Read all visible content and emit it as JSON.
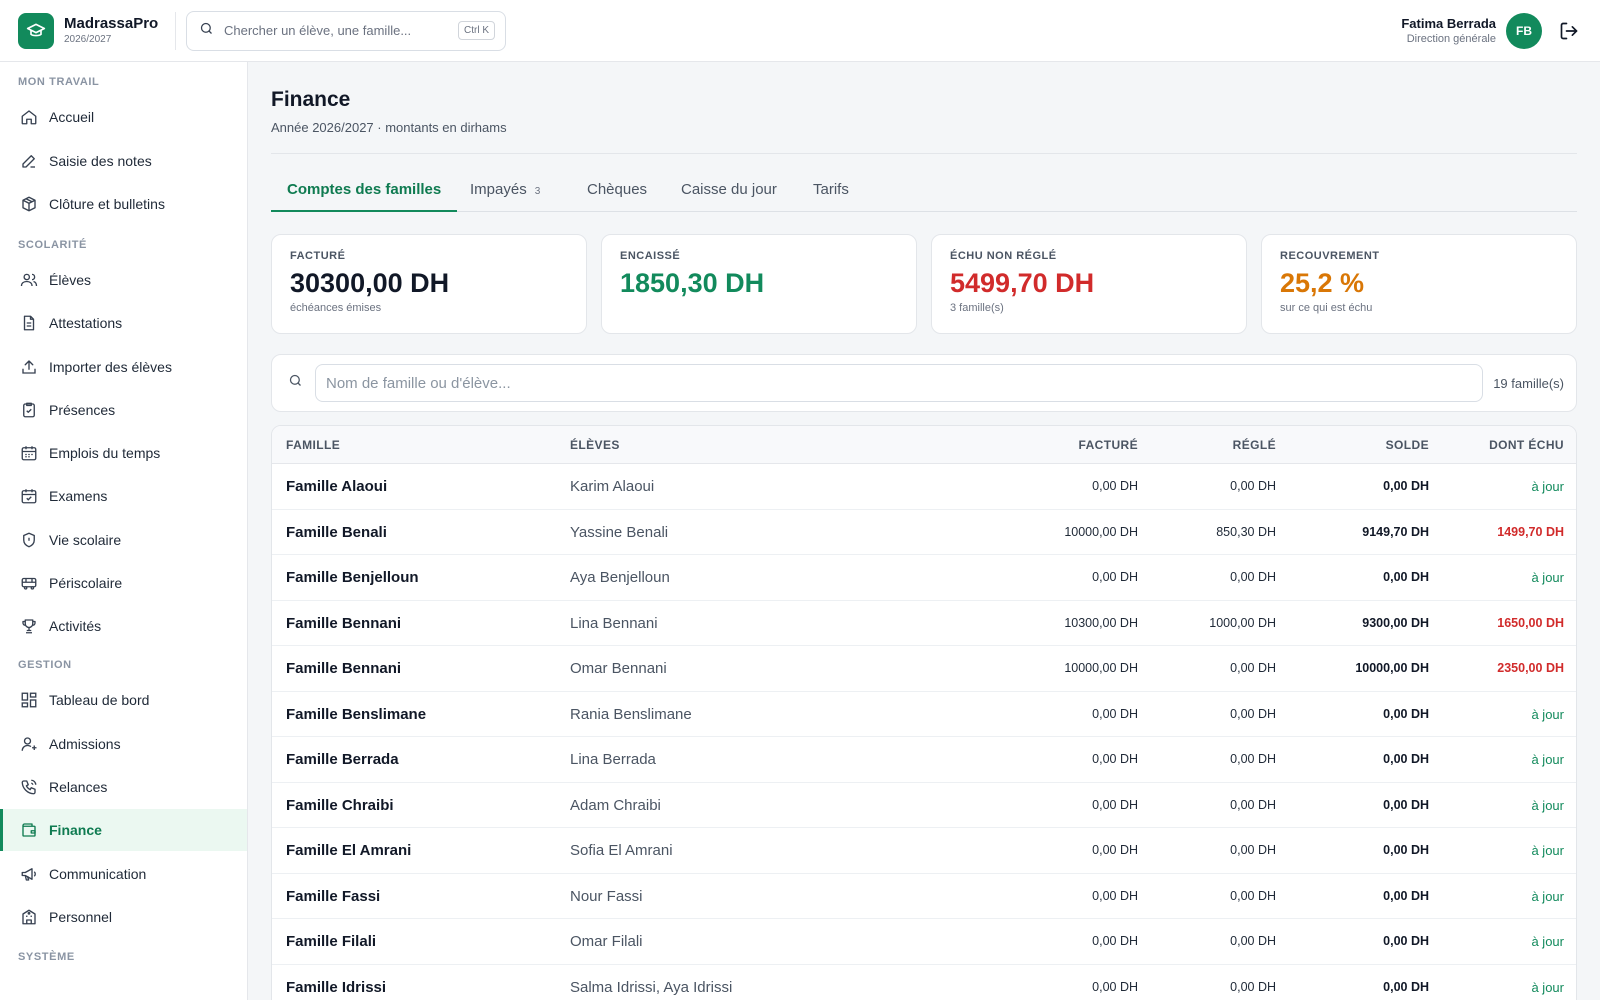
{
  "app": {
    "name": "MadrassaPro",
    "year": "2026/2027",
    "accent": "#128a5c"
  },
  "search": {
    "placeholder": "Chercher un élève, une famille...",
    "shortcut": "Ctrl K"
  },
  "user": {
    "name": "Fatima Berrada",
    "role": "Direction générale",
    "initials": "FB"
  },
  "sidebar": {
    "sections": [
      {
        "title": "MON TRAVAIL",
        "items": [
          {
            "label": "Accueil",
            "icon": "home-icon"
          },
          {
            "label": "Saisie des notes",
            "icon": "pencil-icon"
          },
          {
            "label": "Clôture et bulletins",
            "icon": "package-icon"
          }
        ]
      },
      {
        "title": "SCOLARITÉ",
        "items": [
          {
            "label": "Élèves",
            "icon": "users-icon"
          },
          {
            "label": "Attestations",
            "icon": "document-icon"
          },
          {
            "label": "Importer des élèves",
            "icon": "upload-icon"
          },
          {
            "label": "Présences",
            "icon": "clipboard-check-icon"
          },
          {
            "label": "Emplois du temps",
            "icon": "calendar-grid-icon"
          },
          {
            "label": "Examens",
            "icon": "calendar-check-icon"
          },
          {
            "label": "Vie scolaire",
            "icon": "shield-icon"
          },
          {
            "label": "Périscolaire",
            "icon": "bus-icon"
          },
          {
            "label": "Activités",
            "icon": "trophy-icon"
          }
        ]
      },
      {
        "title": "GESTION",
        "items": [
          {
            "label": "Tableau de bord",
            "icon": "dashboard-icon"
          },
          {
            "label": "Admissions",
            "icon": "user-plus-icon"
          },
          {
            "label": "Relances",
            "icon": "phone-icon"
          },
          {
            "label": "Finance",
            "icon": "wallet-icon",
            "active": true
          },
          {
            "label": "Communication",
            "icon": "megaphone-icon"
          },
          {
            "label": "Personnel",
            "icon": "building-icon"
          }
        ]
      },
      {
        "title": "SYSTÈME",
        "items": []
      }
    ]
  },
  "page": {
    "title": "Finance",
    "subtitle": "Année 2026/2027 · montants en dirhams"
  },
  "tabs": [
    {
      "label": "Comptes des familles",
      "active": true
    },
    {
      "label": "Impayés",
      "badge": "3"
    },
    {
      "label": "Chèques"
    },
    {
      "label": "Caisse du jour"
    },
    {
      "label": "Tarifs"
    }
  ],
  "kpis": [
    {
      "label": "FACTURÉ",
      "value": "30300,00 DH",
      "desc": "échéances émises",
      "color": "#111827"
    },
    {
      "label": "ENCAISSÉ",
      "value": "1850,30 DH",
      "desc": "",
      "color": "#128a5c"
    },
    {
      "label": "ÉCHU NON RÉGLÉ",
      "value": "5499,70 DH",
      "desc": "3 famille(s)",
      "color": "#d12b2b"
    },
    {
      "label": "RECOUVREMENT",
      "value": "25,2 %",
      "desc": "sur ce qui est échu",
      "color": "#d97706"
    }
  ],
  "filter": {
    "placeholder": "Nom de famille ou d'élève...",
    "count": "19 famille(s)"
  },
  "table": {
    "headers": {
      "famille": "FAMILLE",
      "eleves": "ÉLÈVES",
      "facture": "FACTURÉ",
      "regle": "RÉGLÉ",
      "solde": "SOLDE",
      "echu": "DONT ÉCHU"
    },
    "rows": [
      {
        "famille": "Famille Alaoui",
        "eleves": "Karim Alaoui",
        "facture": "0,00 DH",
        "regle": "0,00 DH",
        "solde": "0,00 DH",
        "echu": "à jour",
        "status": "ok"
      },
      {
        "famille": "Famille Benali",
        "eleves": "Yassine Benali",
        "facture": "10000,00 DH",
        "regle": "850,30 DH",
        "solde": "9149,70 DH",
        "echu": "1499,70 DH",
        "status": "due"
      },
      {
        "famille": "Famille Benjelloun",
        "eleves": "Aya Benjelloun",
        "facture": "0,00 DH",
        "regle": "0,00 DH",
        "solde": "0,00 DH",
        "echu": "à jour",
        "status": "ok"
      },
      {
        "famille": "Famille Bennani",
        "eleves": "Lina Bennani",
        "facture": "10300,00 DH",
        "regle": "1000,00 DH",
        "solde": "9300,00 DH",
        "echu": "1650,00 DH",
        "status": "due"
      },
      {
        "famille": "Famille Bennani",
        "eleves": "Omar Bennani",
        "facture": "10000,00 DH",
        "regle": "0,00 DH",
        "solde": "10000,00 DH",
        "echu": "2350,00 DH",
        "status": "due"
      },
      {
        "famille": "Famille Benslimane",
        "eleves": "Rania Benslimane",
        "facture": "0,00 DH",
        "regle": "0,00 DH",
        "solde": "0,00 DH",
        "echu": "à jour",
        "status": "ok"
      },
      {
        "famille": "Famille Berrada",
        "eleves": "Lina Berrada",
        "facture": "0,00 DH",
        "regle": "0,00 DH",
        "solde": "0,00 DH",
        "echu": "à jour",
        "status": "ok"
      },
      {
        "famille": "Famille Chraibi",
        "eleves": "Adam Chraibi",
        "facture": "0,00 DH",
        "regle": "0,00 DH",
        "solde": "0,00 DH",
        "echu": "à jour",
        "status": "ok"
      },
      {
        "famille": "Famille El Amrani",
        "eleves": "Sofia El Amrani",
        "facture": "0,00 DH",
        "regle": "0,00 DH",
        "solde": "0,00 DH",
        "echu": "à jour",
        "status": "ok"
      },
      {
        "famille": "Famille Fassi",
        "eleves": "Nour Fassi",
        "facture": "0,00 DH",
        "regle": "0,00 DH",
        "solde": "0,00 DH",
        "echu": "à jour",
        "status": "ok"
      },
      {
        "famille": "Famille Filali",
        "eleves": "Omar Filali",
        "facture": "0,00 DH",
        "regle": "0,00 DH",
        "solde": "0,00 DH",
        "echu": "à jour",
        "status": "ok"
      },
      {
        "famille": "Famille Idrissi",
        "eleves": "Salma Idrissi, Aya Idrissi",
        "facture": "0,00 DH",
        "regle": "0,00 DH",
        "solde": "0,00 DH",
        "echu": "à jour",
        "status": "ok"
      }
    ]
  }
}
